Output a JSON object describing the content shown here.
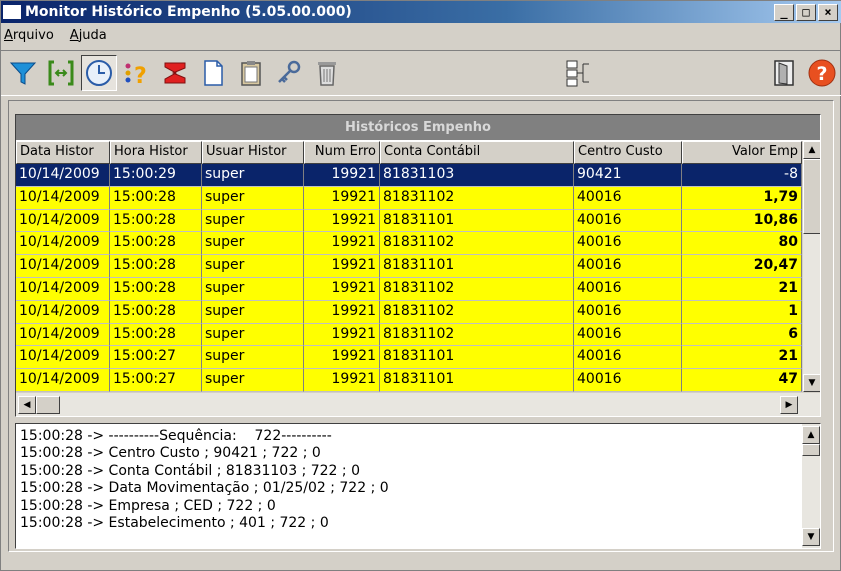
{
  "window": {
    "title": "Monitor Histórico Empenho (5.05.00.000)",
    "min_label": "_",
    "max_label": "□",
    "close_label": "×"
  },
  "menu": [
    {
      "label": "Arquivo",
      "accel": "A",
      "rest": "rquivo"
    },
    {
      "label": "Ajuda",
      "accel": "A",
      "rest": "juda"
    }
  ],
  "toolbar": {
    "icons": [
      "filter-icon",
      "range-icon",
      "clock-icon",
      "help-query-icon",
      "sum-icon",
      "new-document-icon",
      "clipboard-icon",
      "key-icon",
      "trash-icon",
      "network-icon",
      "exit-door-icon",
      "help-icon"
    ]
  },
  "grid": {
    "caption": "Históricos Empenho",
    "columns": [
      "Data Histor",
      "Hora Histor",
      "Usuar Histor",
      "Num Erro",
      "Conta Contábil",
      "Centro Custo",
      "Valor Emp"
    ],
    "rows": [
      {
        "style": "selected",
        "cells": [
          "10/14/2009",
          "15:00:29",
          "super",
          "19921",
          "81831103",
          "90421",
          "-8"
        ]
      },
      {
        "style": "yellow",
        "cells": [
          "10/14/2009",
          "15:00:28",
          "super",
          "19921",
          "81831102",
          "40016",
          "1,79"
        ]
      },
      {
        "style": "yellow",
        "cells": [
          "10/14/2009",
          "15:00:28",
          "super",
          "19921",
          "81831101",
          "40016",
          "10,86"
        ]
      },
      {
        "style": "yellow",
        "cells": [
          "10/14/2009",
          "15:00:28",
          "super",
          "19921",
          "81831102",
          "40016",
          "80"
        ]
      },
      {
        "style": "yellow",
        "cells": [
          "10/14/2009",
          "15:00:28",
          "super",
          "19921",
          "81831101",
          "40016",
          "20,47"
        ]
      },
      {
        "style": "yellow",
        "cells": [
          "10/14/2009",
          "15:00:28",
          "super",
          "19921",
          "81831102",
          "40016",
          "21"
        ]
      },
      {
        "style": "yellow",
        "cells": [
          "10/14/2009",
          "15:00:28",
          "super",
          "19921",
          "81831102",
          "40016",
          "1"
        ]
      },
      {
        "style": "yellow",
        "cells": [
          "10/14/2009",
          "15:00:28",
          "super",
          "19921",
          "81831102",
          "40016",
          "6"
        ]
      },
      {
        "style": "yellow",
        "cells": [
          "10/14/2009",
          "15:00:27",
          "super",
          "19921",
          "81831101",
          "40016",
          "21"
        ]
      },
      {
        "style": "yellow",
        "cells": [
          "10/14/2009",
          "15:00:27",
          "super",
          "19921",
          "81831101",
          "40016",
          "47"
        ]
      }
    ]
  },
  "log": {
    "lines": [
      "15:00:28 -> ----------Sequência:    722----------",
      "15:00:28 -> Centro Custo ; 90421 ; 722 ; 0",
      "15:00:28 -> Conta Contábil ; 81831103 ; 722 ; 0",
      "15:00:28 -> Data Movimentação ; 01/25/02 ; 722 ; 0",
      "15:00:28 -> Empresa ; CED ; 722 ; 0",
      "15:00:28 -> Estabelecimento ; 401 ; 722 ; 0"
    ]
  },
  "colors": {
    "title_bar": "#0a246a",
    "row_highlight": "#ffff00",
    "row_selected": "#0a246a",
    "caption_bg": "#808080"
  }
}
